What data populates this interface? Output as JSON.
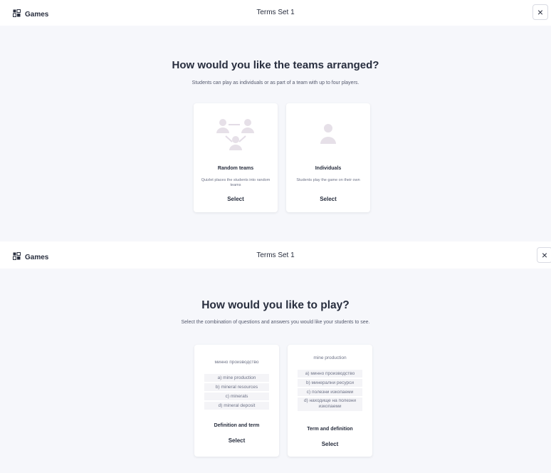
{
  "screens": [
    {
      "topbar": {
        "brand_label": "Games",
        "set_title": "Terms Set 1",
        "close_symbol": "×"
      },
      "heading": "How would you like the teams arranged?",
      "subheading": "Students can play as individuals or as part of a team with up to four players.",
      "cards": [
        {
          "icon": "team-users-icon",
          "title": "Random teams",
          "description": "Quizlet places the students into random teams",
          "select_label": "Select"
        },
        {
          "icon": "user-icon",
          "title": "Individuals",
          "description": "Students play the game on their own",
          "select_label": "Select"
        }
      ]
    },
    {
      "topbar": {
        "brand_label": "Games",
        "set_title": "Terms Set 1",
        "close_symbol": "×"
      },
      "heading": "How would you like to play?",
      "subheading": "Select the combination of questions and answers you would like your students to see.",
      "cards": [
        {
          "question": "минно производство",
          "options": [
            "a) mine production",
            "b) mineral resources",
            "c) minerals",
            "d) mineral deposit"
          ],
          "title": "Definition and term",
          "select_label": "Select"
        },
        {
          "question": "mine production",
          "options": [
            "a) минно производство",
            "b) минерални ресурси",
            "c) полезни изкопаеми",
            "d) находище на полезни изкопаеми"
          ],
          "title": "Term and definition",
          "select_label": "Select"
        }
      ]
    }
  ],
  "colors": {
    "background": "#f6f7fb",
    "card": "#ffffff",
    "text": "#282e3e",
    "muted": "#6e7387",
    "icon": "#e6e0e8"
  }
}
